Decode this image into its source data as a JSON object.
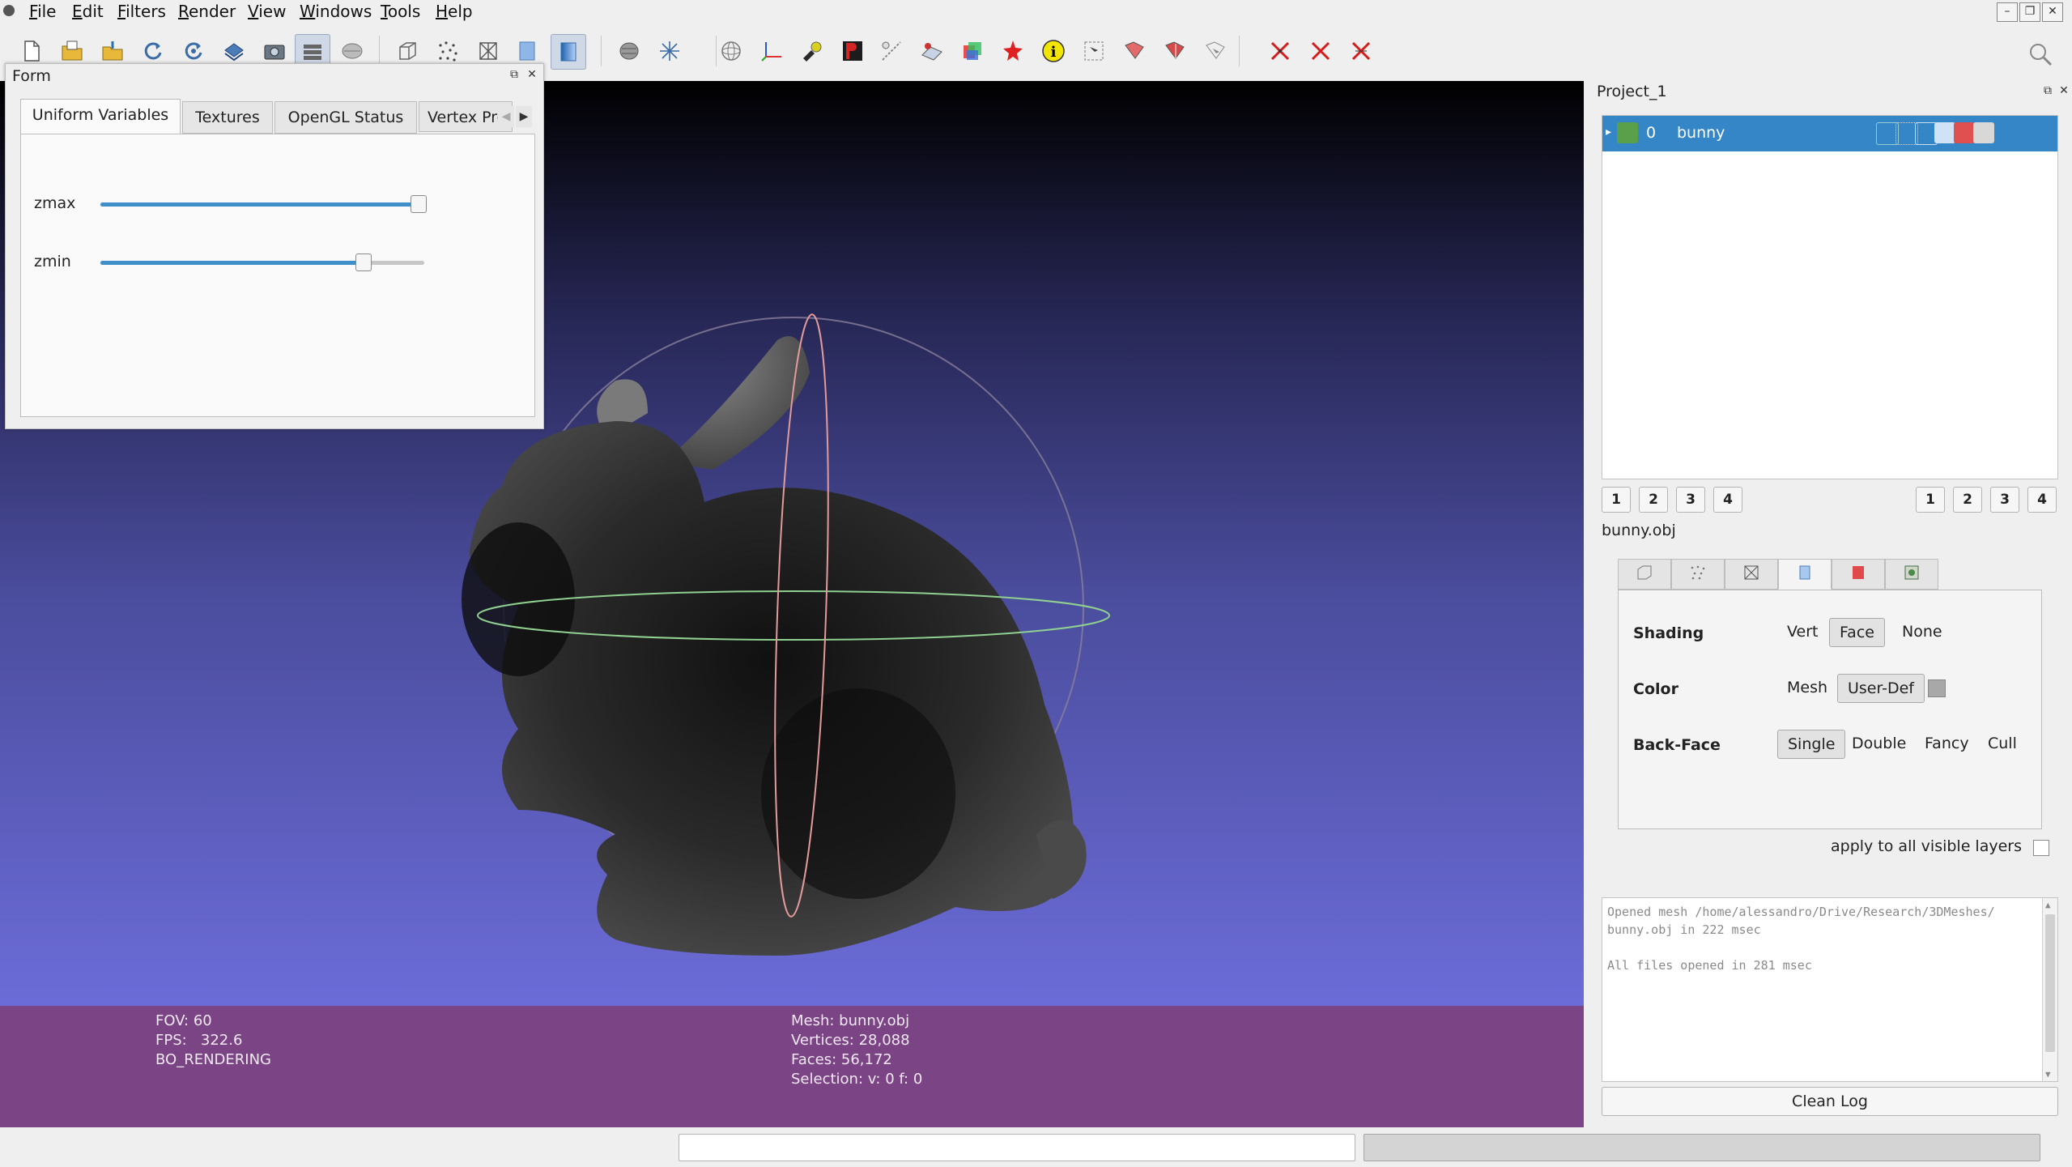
{
  "menubar": {
    "items": [
      "File",
      "Edit",
      "Filters",
      "Render",
      "View",
      "Windows",
      "Tools",
      "Help"
    ]
  },
  "form_panel": {
    "title": "Form",
    "tabs": [
      "Uniform Variables",
      "Textures",
      "OpenGL Status",
      "Vertex Pro"
    ],
    "sliders": [
      {
        "label": "zmax",
        "fraction": 0.98
      },
      {
        "label": "zmin",
        "fraction": 0.81
      }
    ]
  },
  "viewport": {
    "info_left": [
      "FOV: 60",
      "FPS:   322.6",
      "BO_RENDERING"
    ],
    "info_right": [
      "Mesh: bunny.obj",
      "Vertices: 28,088",
      "Faces: 56,172",
      "Selection: v: 0 f: 0"
    ]
  },
  "project_panel": {
    "title": "Project_1",
    "layer": {
      "index": "0",
      "name": "bunny"
    },
    "numbers_left": [
      "1",
      "2",
      "3",
      "4"
    ],
    "numbers_right": [
      "1",
      "2",
      "3",
      "4"
    ],
    "file_label": "bunny.obj",
    "shading": {
      "label": "Shading",
      "options": [
        "Vert",
        "Face",
        "None"
      ],
      "selected": "Face"
    },
    "color": {
      "label": "Color",
      "options": [
        "Mesh",
        "User-Def"
      ],
      "selected": "User-Def"
    },
    "backface": {
      "label": "Back-Face",
      "options": [
        "Single",
        "Double",
        "Fancy",
        "Cull"
      ],
      "selected": "Single"
    },
    "apply_label": "apply to all visible layers",
    "log_lines": [
      "Opened mesh /home/alessandro/Drive/Research/3DMeshes/",
      "bunny.obj in 222 msec",
      "All files opened in 281 msec"
    ],
    "clean_log": "Clean Log"
  },
  "colors": {
    "accent": "#3586c6",
    "info_bar": "#7b4484",
    "viewport_bottom": "#6c6cd8"
  }
}
